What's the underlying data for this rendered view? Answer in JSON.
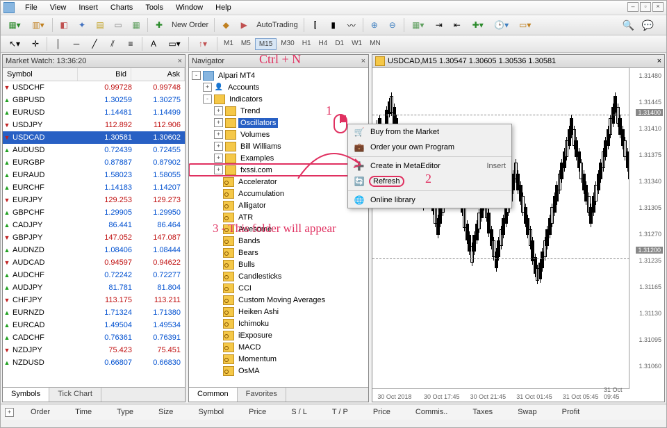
{
  "menu": [
    "File",
    "View",
    "Insert",
    "Charts",
    "Tools",
    "Window",
    "Help"
  ],
  "toolbar": {
    "new_order": "New Order",
    "autotrading": "AutoTrading"
  },
  "timeframes": [
    "M1",
    "M5",
    "M15",
    "M30",
    "H1",
    "H4",
    "D1",
    "W1",
    "MN"
  ],
  "timeframe_active": "M15",
  "market_watch": {
    "title": "Market Watch: 13:36:20",
    "cols": [
      "Symbol",
      "Bid",
      "Ask"
    ],
    "rows": [
      {
        "s": "USDCHF",
        "b": "0.99728",
        "a": "0.99748",
        "d": "down"
      },
      {
        "s": "GBPUSD",
        "b": "1.30259",
        "a": "1.30275",
        "d": "up"
      },
      {
        "s": "EURUSD",
        "b": "1.14481",
        "a": "1.14499",
        "d": "up"
      },
      {
        "s": "USDJPY",
        "b": "112.892",
        "a": "112.906",
        "d": "down"
      },
      {
        "s": "USDCAD",
        "b": "1.30581",
        "a": "1.30602",
        "d": "down",
        "sel": true
      },
      {
        "s": "AUDUSD",
        "b": "0.72439",
        "a": "0.72455",
        "d": "up"
      },
      {
        "s": "EURGBP",
        "b": "0.87887",
        "a": "0.87902",
        "d": "up"
      },
      {
        "s": "EURAUD",
        "b": "1.58023",
        "a": "1.58055",
        "d": "up"
      },
      {
        "s": "EURCHF",
        "b": "1.14183",
        "a": "1.14207",
        "d": "up"
      },
      {
        "s": "EURJPY",
        "b": "129.253",
        "a": "129.273",
        "d": "down"
      },
      {
        "s": "GBPCHF",
        "b": "1.29905",
        "a": "1.29950",
        "d": "up"
      },
      {
        "s": "CADJPY",
        "b": "86.441",
        "a": "86.464",
        "d": "up"
      },
      {
        "s": "GBPJPY",
        "b": "147.052",
        "a": "147.087",
        "d": "down"
      },
      {
        "s": "AUDNZD",
        "b": "1.08406",
        "a": "1.08444",
        "d": "up"
      },
      {
        "s": "AUDCAD",
        "b": "0.94597",
        "a": "0.94622",
        "d": "down"
      },
      {
        "s": "AUDCHF",
        "b": "0.72242",
        "a": "0.72277",
        "d": "up"
      },
      {
        "s": "AUDJPY",
        "b": "81.781",
        "a": "81.804",
        "d": "up"
      },
      {
        "s": "CHFJPY",
        "b": "113.175",
        "a": "113.211",
        "d": "down"
      },
      {
        "s": "EURNZD",
        "b": "1.71324",
        "a": "1.71380",
        "d": "up"
      },
      {
        "s": "EURCAD",
        "b": "1.49504",
        "a": "1.49534",
        "d": "up"
      },
      {
        "s": "CADCHF",
        "b": "0.76361",
        "a": "0.76391",
        "d": "up"
      },
      {
        "s": "NZDJPY",
        "b": "75.423",
        "a": "75.451",
        "d": "down"
      },
      {
        "s": "NZDUSD",
        "b": "0.66807",
        "a": "0.66830",
        "d": "up"
      }
    ],
    "tabs": [
      "Symbols",
      "Tick Chart"
    ]
  },
  "navigator": {
    "title": "Navigator",
    "root": "Alpari MT4",
    "accounts": "Accounts",
    "indicators": "Indicators",
    "groups": [
      "Trend",
      "Oscillators",
      "Volumes",
      "Bill Williams",
      "Examples",
      "fxssi.com"
    ],
    "selected_group": "Oscillators",
    "boxed_group": "fxssi.com",
    "items": [
      "Accelerator",
      "Accumulation",
      "Alligator",
      "ATR",
      "Awesome",
      "Bands",
      "Bears",
      "Bulls",
      "Candlesticks",
      "CCI",
      "Custom Moving Averages",
      "Heiken Ashi",
      "Ichimoku",
      "iExposure",
      "MACD",
      "Momentum",
      "OsMA"
    ],
    "tabs": [
      "Common",
      "Favorites"
    ]
  },
  "chart": {
    "title": "USDCAD,M15  1.30547 1.30605 1.30536 1.30581",
    "ylabels": [
      "1.31480",
      "1.31445",
      "1.31410",
      "1.31375",
      "1.31340",
      "1.31305",
      "1.31270",
      "1.31235",
      "1.31165",
      "1.31130",
      "1.31095",
      "1.31060"
    ],
    "price_lines": [
      {
        "v": "1.31400",
        "pct": 14
      },
      {
        "v": "1.31200",
        "pct": 57
      }
    ],
    "xlabels": [
      {
        "t": "30 Oct 2018",
        "pct": 2
      },
      {
        "t": "30 Oct 17:45",
        "pct": 20
      },
      {
        "t": "30 Oct 21:45",
        "pct": 38
      },
      {
        "t": "31 Oct 01:45",
        "pct": 56
      },
      {
        "t": "31 Oct 05:45",
        "pct": 74
      },
      {
        "t": "31 Oct 09:45",
        "pct": 90
      }
    ]
  },
  "context_menu": [
    {
      "icon": "🛒",
      "label": "Buy from the Market"
    },
    {
      "icon": "💼",
      "label": "Order your own Program"
    },
    {
      "sep": true
    },
    {
      "icon": "➕",
      "label": "Create in MetaEditor",
      "accel": "Insert"
    },
    {
      "icon": "🔄",
      "label": "Refresh",
      "hl": true
    },
    {
      "sep": true
    },
    {
      "icon": "🌐",
      "label": "Online library"
    }
  ],
  "bottom_cols": [
    "Order",
    "Time",
    "Type",
    "Size",
    "Symbol",
    "Price",
    "S / L",
    "T / P",
    "Price",
    "Commis..",
    "Taxes",
    "Swap",
    "Profit"
  ],
  "annotations": {
    "ctrl_n": "Ctrl + N",
    "one": "1",
    "two": "2",
    "three": "3 - This folder will appear"
  }
}
